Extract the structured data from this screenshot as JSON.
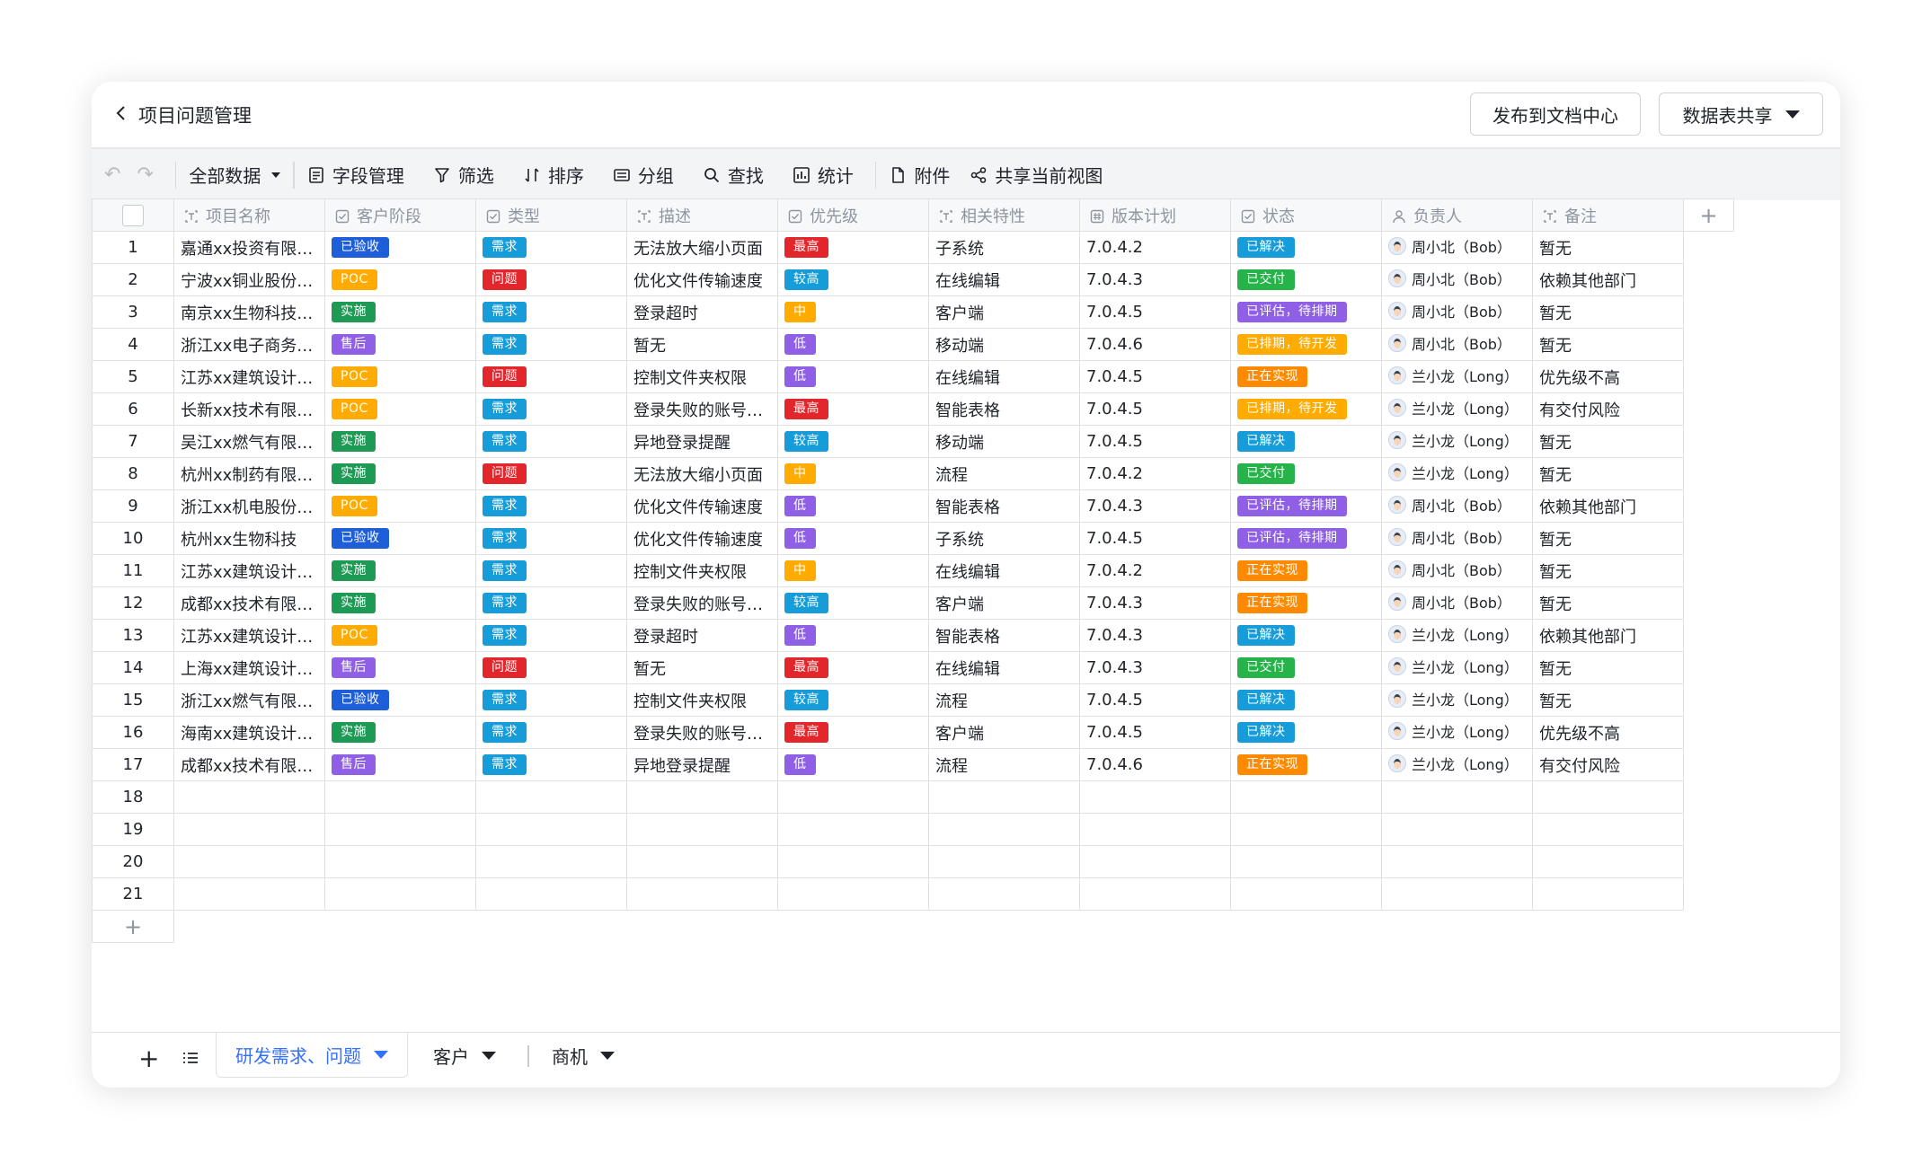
{
  "header": {
    "title": "项目问题管理",
    "publish_label": "发布到文档中心",
    "share_label": "数据表共享"
  },
  "toolbar": {
    "undo": "↶",
    "redo": "↷",
    "all_data": "全部数据",
    "fields": "字段管理",
    "filter": "筛选",
    "sort": "排序",
    "group": "分组",
    "find": "查找",
    "stats": "统计",
    "attach": "附件",
    "share_view": "共享当前视图"
  },
  "columns": [
    {
      "label": "项目名称",
      "icon": "text-field-icon"
    },
    {
      "label": "客户阶段",
      "icon": "single-select-icon"
    },
    {
      "label": "类型",
      "icon": "single-select-icon"
    },
    {
      "label": "描述",
      "icon": "text-field-icon"
    },
    {
      "label": "优先级",
      "icon": "single-select-icon"
    },
    {
      "label": "相关特性",
      "icon": "text-field-icon"
    },
    {
      "label": "版本计划",
      "icon": "number-field-icon"
    },
    {
      "label": "状态",
      "icon": "single-select-icon"
    },
    {
      "label": "负责人",
      "icon": "person-field-icon"
    },
    {
      "label": "备注",
      "icon": "text-field-icon"
    }
  ],
  "add_column": "+",
  "tag_colors": {
    "已验收": "#1e5ed8",
    "POC": "#ffab00",
    "实施": "#1d9b54",
    "售后": "#8f60e6",
    "需求": "#169cd8",
    "问题": "#e3262b",
    "最高": "#e3262b",
    "较高": "#169cd8",
    "中": "#ffab00",
    "低": "#8f60e6",
    "已解决": "#169cd8",
    "已交付": "#25b34a",
    "已评估，待排期": "#8f60e6",
    "已排期，待开发": "#ffab00",
    "正在实现": "#ff8a00"
  },
  "rows": [
    {
      "n": "1",
      "name": "嘉通xx投资有限…",
      "stage": "已验收",
      "type": "需求",
      "desc": "无法放大缩小页面",
      "priority": "最高",
      "feature": "子系统",
      "version": "7.0.4.2",
      "status": "已解决",
      "owner": "周小北（Bob）",
      "note": "暂无"
    },
    {
      "n": "2",
      "name": "宁波xx铜业股份…",
      "stage": "POC",
      "type": "问题",
      "desc": "优化文件传输速度",
      "priority": "较高",
      "feature": "在线编辑",
      "version": "7.0.4.3",
      "status": "已交付",
      "owner": "周小北（Bob）",
      "note": "依赖其他部门"
    },
    {
      "n": "3",
      "name": "南京xx生物科技…",
      "stage": "实施",
      "type": "需求",
      "desc": "登录超时",
      "priority": "中",
      "feature": "客户端",
      "version": "7.0.4.5",
      "status": "已评估，待排期",
      "owner": "周小北（Bob）",
      "note": "暂无"
    },
    {
      "n": "4",
      "name": "浙江xx电子商务…",
      "stage": "售后",
      "type": "需求",
      "desc": "暂无",
      "priority": "低",
      "feature": "移动端",
      "version": "7.0.4.6",
      "status": "已排期，待开发",
      "owner": "周小北（Bob）",
      "note": "暂无"
    },
    {
      "n": "5",
      "name": "江苏xx建筑设计…",
      "stage": "POC",
      "type": "问题",
      "desc": "控制文件夹权限",
      "priority": "低",
      "feature": "在线编辑",
      "version": "7.0.4.5",
      "status": "正在实现",
      "owner": "兰小龙（Long）",
      "note": "优先级不高"
    },
    {
      "n": "6",
      "name": "长新xx技术有限…",
      "stage": "POC",
      "type": "需求",
      "desc": "登录失败的账号…",
      "priority": "最高",
      "feature": "智能表格",
      "version": "7.0.4.5",
      "status": "已排期，待开发",
      "owner": "兰小龙（Long）",
      "note": "有交付风险"
    },
    {
      "n": "7",
      "name": "吴江xx燃气有限…",
      "stage": "实施",
      "type": "需求",
      "desc": "异地登录提醒",
      "priority": "较高",
      "feature": "移动端",
      "version": "7.0.4.5",
      "status": "已解决",
      "owner": "兰小龙（Long）",
      "note": "暂无"
    },
    {
      "n": "8",
      "name": "杭州xx制药有限…",
      "stage": "实施",
      "type": "问题",
      "desc": "无法放大缩小页面",
      "priority": "中",
      "feature": "流程",
      "version": "7.0.4.2",
      "status": "已交付",
      "owner": "兰小龙（Long）",
      "note": "暂无"
    },
    {
      "n": "9",
      "name": "浙江xx机电股份…",
      "stage": "POC",
      "type": "需求",
      "desc": "优化文件传输速度",
      "priority": "低",
      "feature": "智能表格",
      "version": "7.0.4.3",
      "status": "已评估，待排期",
      "owner": "周小北（Bob）",
      "note": "依赖其他部门"
    },
    {
      "n": "10",
      "name": "杭州xx生物科技",
      "stage": "已验收",
      "type": "需求",
      "desc": "优化文件传输速度",
      "priority": "低",
      "feature": "子系统",
      "version": "7.0.4.5",
      "status": "已评估，待排期",
      "owner": "周小北（Bob）",
      "note": "暂无"
    },
    {
      "n": "11",
      "name": "江苏xx建筑设计…",
      "stage": "实施",
      "type": "需求",
      "desc": "控制文件夹权限",
      "priority": "中",
      "feature": "在线编辑",
      "version": "7.0.4.2",
      "status": "正在实现",
      "owner": "周小北（Bob）",
      "note": "暂无"
    },
    {
      "n": "12",
      "name": "成都xx技术有限…",
      "stage": "实施",
      "type": "需求",
      "desc": "登录失败的账号…",
      "priority": "较高",
      "feature": "客户端",
      "version": "7.0.4.3",
      "status": "正在实现",
      "owner": "周小北（Bob）",
      "note": "暂无"
    },
    {
      "n": "13",
      "name": "江苏xx建筑设计…",
      "stage": "POC",
      "type": "需求",
      "desc": "登录超时",
      "priority": "低",
      "feature": "智能表格",
      "version": "7.0.4.3",
      "status": "已解决",
      "owner": "兰小龙（Long）",
      "note": "依赖其他部门"
    },
    {
      "n": "14",
      "name": "上海xx建筑设计…",
      "stage": "售后",
      "type": "问题",
      "desc": "暂无",
      "priority": "最高",
      "feature": "在线编辑",
      "version": "7.0.4.3",
      "status": "已交付",
      "owner": "兰小龙（Long）",
      "note": "暂无"
    },
    {
      "n": "15",
      "name": "浙江xx燃气有限…",
      "stage": "已验收",
      "type": "需求",
      "desc": "控制文件夹权限",
      "priority": "较高",
      "feature": "流程",
      "version": "7.0.4.5",
      "status": "已解决",
      "owner": "兰小龙（Long）",
      "note": "暂无"
    },
    {
      "n": "16",
      "name": "海南xx建筑设计…",
      "stage": "实施",
      "type": "需求",
      "desc": "登录失败的账号…",
      "priority": "最高",
      "feature": "客户端",
      "version": "7.0.4.5",
      "status": "已解决",
      "owner": "兰小龙（Long）",
      "note": "优先级不高"
    },
    {
      "n": "17",
      "name": "成都xx技术有限…",
      "stage": "售后",
      "type": "需求",
      "desc": "异地登录提醒",
      "priority": "低",
      "feature": "流程",
      "version": "7.0.4.6",
      "status": "正在实现",
      "owner": "兰小龙（Long）",
      "note": "有交付风险"
    }
  ],
  "empty_rows": [
    "18",
    "19",
    "20",
    "21"
  ],
  "add_row": "+",
  "footer": {
    "add": "+",
    "tabs": [
      {
        "label": "研发需求、问题",
        "active": true
      },
      {
        "label": "客户",
        "active": false
      },
      {
        "label": "商机",
        "active": false
      }
    ]
  }
}
